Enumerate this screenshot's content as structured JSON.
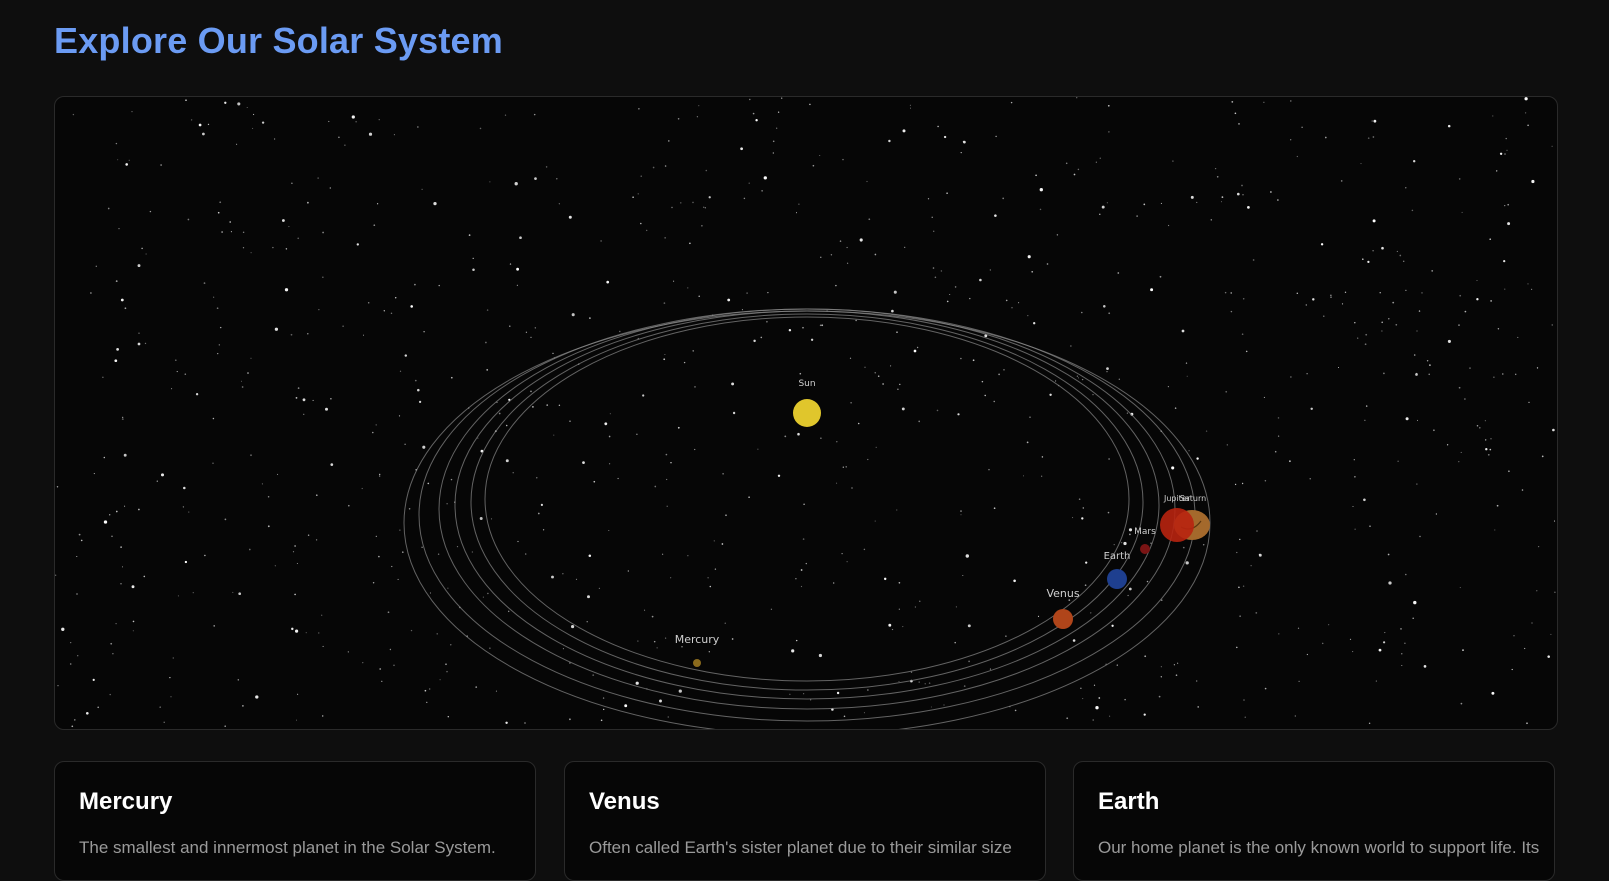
{
  "page": {
    "title": "Explore Our Solar System"
  },
  "solar_system": {
    "sun": {
      "label": "Sun",
      "color": "#e0c62c"
    },
    "planets": [
      {
        "name": "Mercury",
        "color": "#8a6a1d"
      },
      {
        "name": "Venus",
        "color": "#b0451a"
      },
      {
        "name": "Earth",
        "color": "#1e3f8f"
      },
      {
        "name": "Mars",
        "color": "#7a1414"
      },
      {
        "name": "Jupiter",
        "color": "#b8240f"
      },
      {
        "name": "Saturn",
        "color": "#a4692c"
      }
    ],
    "orbit_color": "#8c8c8c",
    "background": "#060606"
  },
  "cards": [
    {
      "title": "Mercury",
      "description": "The smallest and innermost planet in the Solar System."
    },
    {
      "title": "Venus",
      "description": "Often called Earth's sister planet due to their similar size"
    },
    {
      "title": "Earth",
      "description": "Our home planet is the only known world to support life. Its"
    }
  ],
  "colors": {
    "accent": "#6b9bf3",
    "page_background": "#0e0e0e",
    "card_background": "#060606",
    "card_border": "#2a2a2a"
  }
}
